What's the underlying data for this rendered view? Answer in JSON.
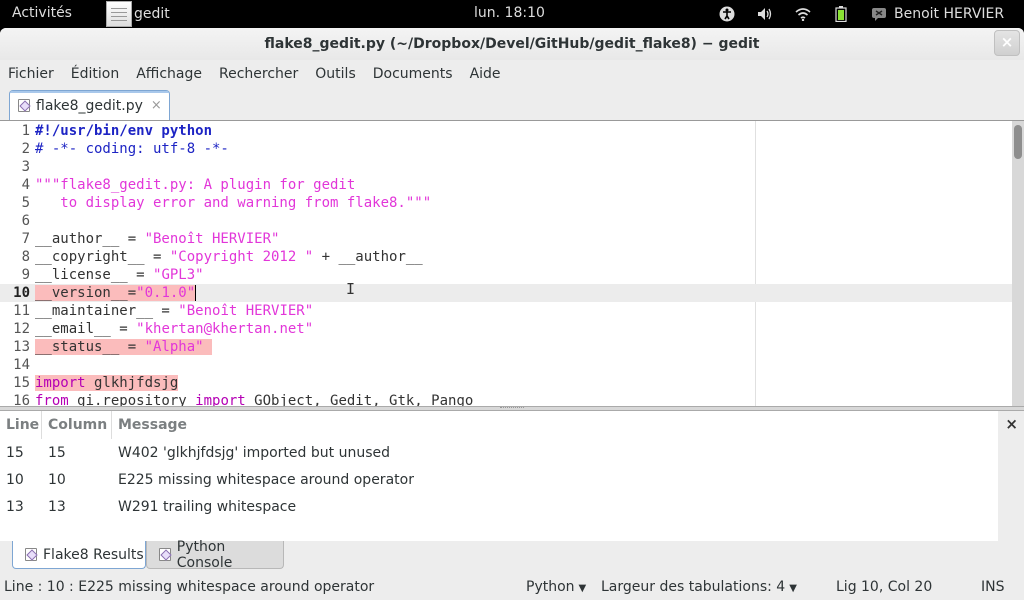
{
  "topbar": {
    "activities": "Activités",
    "app_name": "gedit",
    "clock": "lun. 18:10",
    "icons": [
      "accessibility-icon",
      "volume-icon",
      "wifi-icon",
      "battery-icon",
      "user-status-icon"
    ],
    "user": "Benoit HERVIER"
  },
  "window": {
    "title": "flake8_gedit.py (~/Dropbox/Devel/GitHub/gedit_flake8) − gedit",
    "close_label": "×"
  },
  "menubar": [
    "Fichier",
    "Édition",
    "Affichage",
    "Rechercher",
    "Outils",
    "Documents",
    "Aide"
  ],
  "document_tab": {
    "label": "flake8_gedit.py",
    "close_label": "×"
  },
  "editor": {
    "current_line": 10,
    "lines": [
      {
        "n": "1",
        "segments": [
          {
            "t": "#!/usr/bin/env python",
            "c": "shebang"
          }
        ]
      },
      {
        "n": "2",
        "segments": [
          {
            "t": "# -*- coding: utf-8 -*-",
            "c": "comment"
          }
        ]
      },
      {
        "n": "3",
        "segments": []
      },
      {
        "n": "4",
        "segments": [
          {
            "t": "\"\"\"flake8_gedit.py: A plugin for gedit",
            "c": "str"
          }
        ]
      },
      {
        "n": "5",
        "segments": [
          {
            "t": "   to display error and warning from flake8.\"\"\"",
            "c": "str"
          }
        ]
      },
      {
        "n": "6",
        "segments": []
      },
      {
        "n": "7",
        "segments": [
          {
            "t": "__author__ = ",
            "c": "plain"
          },
          {
            "t": "\"Benoît HERVIER\"",
            "c": "str"
          }
        ]
      },
      {
        "n": "8",
        "segments": [
          {
            "t": "__copyright__ = ",
            "c": "plain"
          },
          {
            "t": "\"Copyright 2012 \"",
            "c": "str"
          },
          {
            "t": " + __author__",
            "c": "plain"
          }
        ]
      },
      {
        "n": "9",
        "segments": [
          {
            "t": "__license__ = ",
            "c": "plain"
          },
          {
            "t": "\"GPL3\"",
            "c": "str"
          }
        ]
      },
      {
        "n": "10",
        "segments": [
          {
            "t": "__version__=",
            "c": "plain",
            "hl": true
          },
          {
            "t": "\"0.1.0\"",
            "c": "str",
            "hl": true
          }
        ]
      },
      {
        "n": "11",
        "segments": [
          {
            "t": "__maintainer__ = ",
            "c": "plain"
          },
          {
            "t": "\"Benoît HERVIER\"",
            "c": "str"
          }
        ]
      },
      {
        "n": "12",
        "segments": [
          {
            "t": "__email__ = ",
            "c": "plain"
          },
          {
            "t": "\"khertan@khertan.net\"",
            "c": "str"
          }
        ]
      },
      {
        "n": "13",
        "segments": [
          {
            "t": "__status__ = ",
            "c": "plain",
            "hl": true
          },
          {
            "t": "\"Alpha\" ",
            "c": "str",
            "hl": true
          }
        ]
      },
      {
        "n": "14",
        "segments": []
      },
      {
        "n": "15",
        "segments": [
          {
            "t": "import",
            "c": "kw",
            "hl": true
          },
          {
            "t": " glkhjfdsjg",
            "c": "plain",
            "hl": true
          }
        ]
      },
      {
        "n": "16",
        "segments": [
          {
            "t": "from",
            "c": "kw"
          },
          {
            "t": " gi.repository ",
            "c": "plain"
          },
          {
            "t": "import",
            "c": "kw"
          },
          {
            "t": " GObject, Gedit, Gtk, Pango",
            "c": "plain"
          }
        ]
      }
    ]
  },
  "results": {
    "columns": [
      "Line",
      "Column",
      "Message"
    ],
    "rows": [
      {
        "line": "15",
        "column": "15",
        "message": "W402 'glkhjfdsjg' imported but unused"
      },
      {
        "line": "10",
        "column": "10",
        "message": "E225 missing whitespace around operator"
      },
      {
        "line": "13",
        "column": "13",
        "message": "W291 trailing whitespace"
      }
    ],
    "close_label": "×"
  },
  "panel_tabs": [
    {
      "label": "Flake8 Results",
      "active": true
    },
    {
      "label": "Python Console",
      "active": false
    }
  ],
  "statusbar": {
    "message": "Line : 10 : E225 missing whitespace around operator",
    "language": "Python",
    "tab_width": "Largeur des tabulations:  4",
    "position": "Lig 10, Col 20",
    "mode": "INS"
  }
}
